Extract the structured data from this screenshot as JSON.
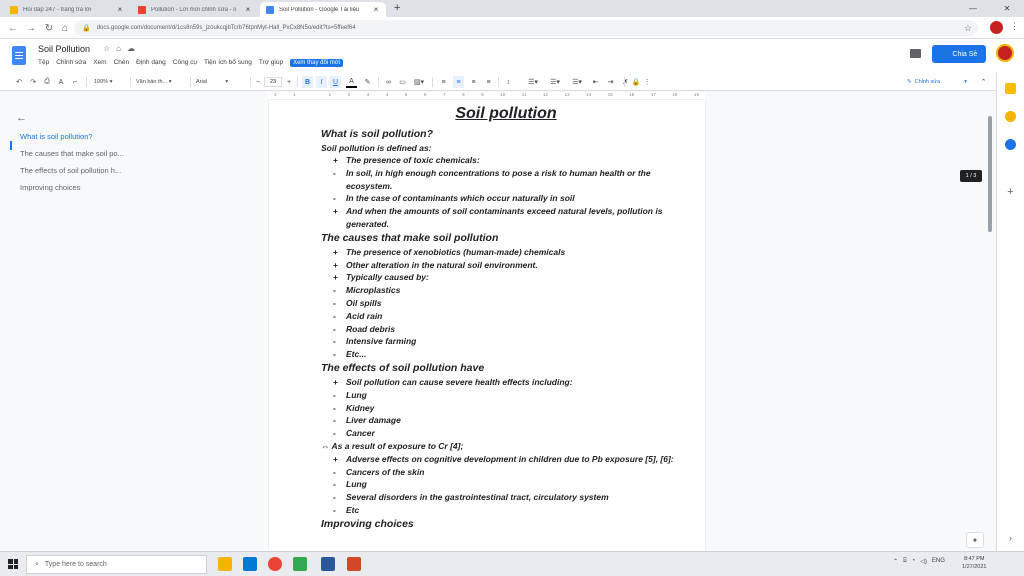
{
  "browser": {
    "tabs": [
      {
        "label": "Hỏi đáp 247 - trang tra lời",
        "favicon_color": "#f4b400",
        "active": false
      },
      {
        "label": "Pollution - Lời mời chỉnh sửa - li",
        "favicon_color": "#ea4335",
        "active": false
      },
      {
        "label": "Soil Pollution - Google Tài liệu",
        "favicon_color": "#4285f4",
        "active": true
      }
    ],
    "new_tab": "+",
    "url": "docs.google.com/document/d/1cs8n59s_jzoukcqjbTcrb76tpnMyt-Hall_PxCx8N5o/edit?ts=5ffeef64"
  },
  "docs": {
    "title": "Soil Pollution",
    "menu": [
      "Tệp",
      "Chỉnh sửa",
      "Xem",
      "Chèn",
      "Định dạng",
      "Công cụ",
      "Tiện ích bổ sung",
      "Trợ giúp"
    ],
    "changes_label": "Xem thay đổi mới",
    "share_label": "Chia Sẻ"
  },
  "toolbar": {
    "zoom": "100%",
    "style": "Văn bản th...",
    "font": "Arial",
    "font_size": "23",
    "bold": "B",
    "italic": "I",
    "underline": "U",
    "text_color": "A",
    "mode": "Chỉnh sửa"
  },
  "ruler_ticks": [
    "2",
    "1",
    "",
    "1",
    "2",
    "3",
    "4",
    "5",
    "6",
    "7",
    "8",
    "9",
    "10",
    "11",
    "12",
    "13",
    "14",
    "15",
    "16",
    "17",
    "18",
    "19"
  ],
  "outline": {
    "items": [
      "What is soil pollution?",
      "The causes that make soil po...",
      "The effects of soil pollution h...",
      "Improving choices"
    ],
    "active_index": 0
  },
  "page_indicator": "1 / 3",
  "document": {
    "title": "Soil pollution",
    "s1_heading": "What is soil pollution?",
    "s1_intro": "Soil pollution is defined as:",
    "s1_items": [
      {
        "m": "+",
        "t": "The presence of toxic chemicals:"
      },
      {
        "m": "-",
        "t": "In soil, in high enough concentrations to pose a risk to human health or the ecosystem."
      },
      {
        "m": "-",
        "t": "In the case of contaminants which occur naturally in soil"
      },
      {
        "m": "+",
        "t": "And when the amounts of soil contaminants exceed natural levels, pollution is generated."
      }
    ],
    "s2_heading": "The causes that make soil pollution",
    "s2_items": [
      {
        "m": "+",
        "t": "The presence of xenobiotics (human-made) chemicals"
      },
      {
        "m": "+",
        "t": "Other alteration in the natural soil environment."
      },
      {
        "m": "+",
        "t": "Typically caused by:"
      },
      {
        "m": "-",
        "t": "Microplastics"
      },
      {
        "m": "-",
        "t": "Oil spills"
      },
      {
        "m": "-",
        "t": "Acid rain"
      },
      {
        "m": "-",
        "t": "Road debris"
      },
      {
        "m": "-",
        "t": "Intensive farming"
      },
      {
        "m": "-",
        "t": "Etc..."
      }
    ],
    "s3_heading": "The effects of soil pollution have",
    "s3_items_a": [
      {
        "m": "+",
        "t": "Soil pollution can cause severe health effects including:"
      },
      {
        "m": "-",
        "t": "Lung"
      },
      {
        "m": "-",
        "t": "Kidney"
      },
      {
        "m": "-",
        "t": "Liver damage"
      },
      {
        "m": "-",
        "t": "Cancer"
      }
    ],
    "s3_arrow": "⇔ As a result of exposure to Cr [4];",
    "s3_items_b": [
      {
        "m": "+",
        "t": "Adverse effects on cognitive development in children due to Pb exposure [5], [6]:"
      },
      {
        "m": "-",
        "t": "Cancers of the skin"
      },
      {
        "m": "-",
        "t": "Lung"
      },
      {
        "m": "-",
        "t": "Several disorders in the gastrointestinal tract, circulatory system"
      },
      {
        "m": "-",
        "t": "Etc"
      }
    ],
    "s4_heading": "Improving choices"
  },
  "taskbar": {
    "search_placeholder": "Type here to search",
    "lang": "ENG",
    "time": "8:47 PM",
    "date": "1/27/2021"
  }
}
